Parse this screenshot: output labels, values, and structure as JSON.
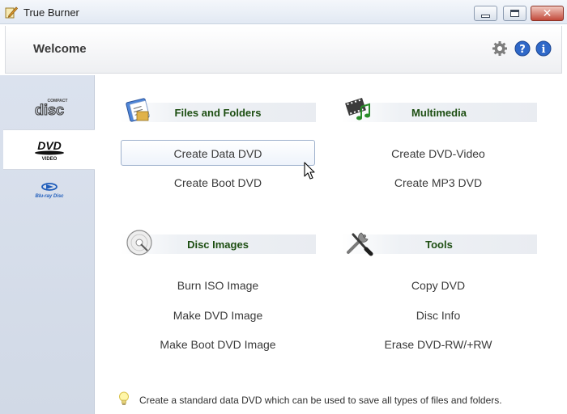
{
  "window": {
    "title": "True Burner",
    "icon": "pen-icon"
  },
  "header": {
    "title": "Welcome",
    "icons": [
      "gear-icon",
      "help-icon",
      "info-icon"
    ]
  },
  "sidebar": {
    "items": [
      {
        "label": "COMPACT",
        "sublabel": "disc",
        "icon": "compact-disc-logo",
        "active": false
      },
      {
        "label": "DVD",
        "sublabel": "VIDEO",
        "icon": "dvd-video-logo",
        "active": true
      },
      {
        "label": "Blu-ray Disc",
        "icon": "blu-ray-logo",
        "active": false
      }
    ]
  },
  "sections": {
    "files": {
      "title": "Files and Folders",
      "icon": "files-folders-icon",
      "actions": [
        "Create Data DVD",
        "Create Boot DVD"
      ]
    },
    "multimedia": {
      "title": "Multimedia",
      "icon": "film-music-icon",
      "actions": [
        "Create DVD-Video",
        "Create MP3 DVD"
      ]
    },
    "images": {
      "title": "Disc Images",
      "icon": "disc-image-icon",
      "actions": [
        "Burn ISO Image",
        "Make DVD Image",
        "Make Boot DVD Image"
      ]
    },
    "tools": {
      "title": "Tools",
      "icon": "tools-icon",
      "actions": [
        "Copy DVD",
        "Disc Info",
        "Erase DVD-RW/+RW"
      ]
    }
  },
  "hovered_action": "Create Data DVD",
  "tip": {
    "icon": "lightbulb-icon",
    "text": "Create a standard data DVD which can be used to save all types of files and folders."
  },
  "colors": {
    "section_title": "#1d4e12",
    "sidebar_bg": "#d6dde9",
    "close_button": "#c2493a"
  }
}
